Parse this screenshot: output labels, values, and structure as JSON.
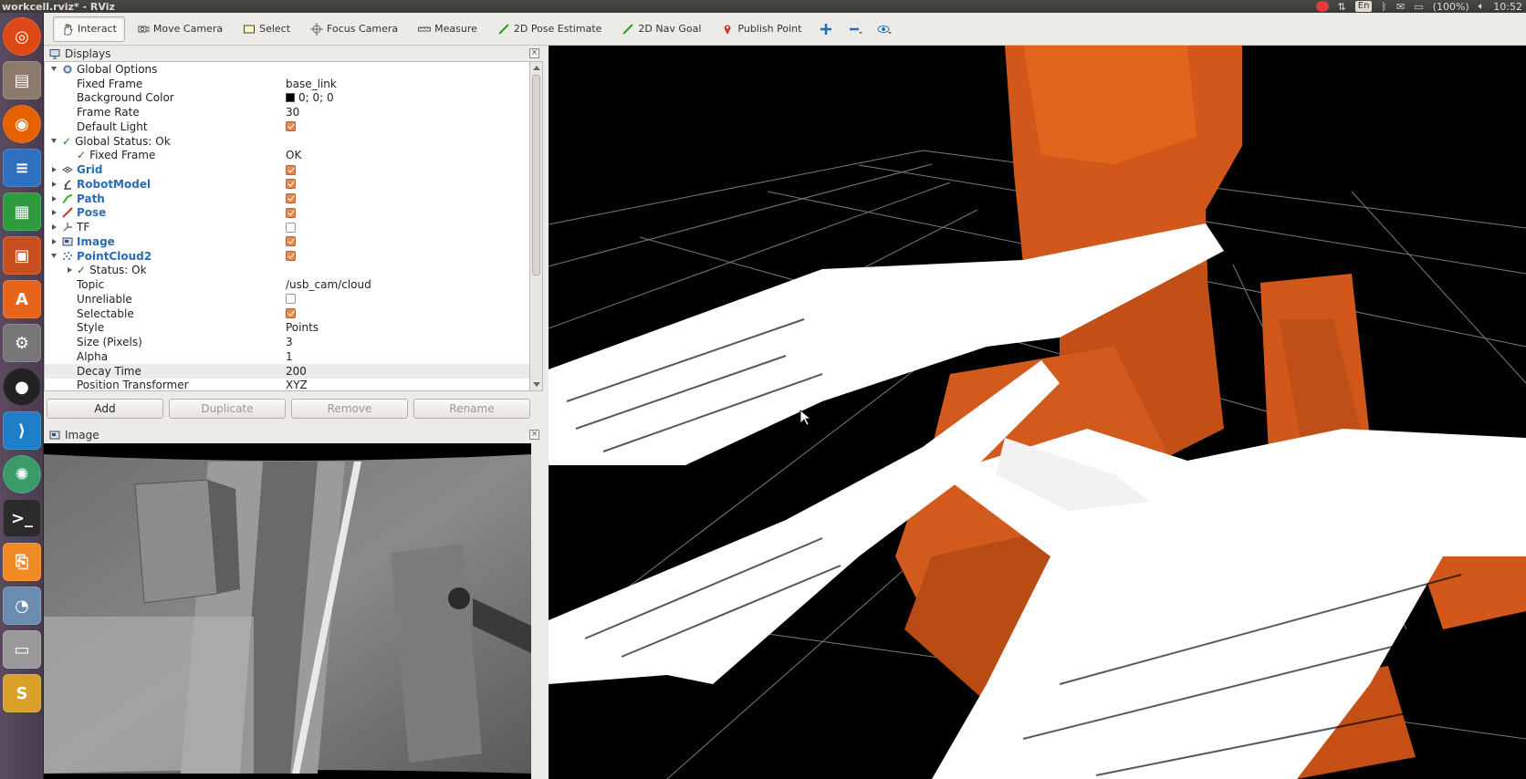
{
  "window": {
    "title": "workcell.rviz* - RViz"
  },
  "tray": {
    "lang": "En",
    "battery": "(100%)",
    "time": "10:52"
  },
  "toolbar": {
    "tools": [
      {
        "label": "Interact",
        "icon": "hand-icon"
      },
      {
        "label": "Move Camera",
        "icon": "move-camera-icon"
      },
      {
        "label": "Select",
        "icon": "select-icon"
      },
      {
        "label": "Focus Camera",
        "icon": "focus-camera-icon"
      },
      {
        "label": "Measure",
        "icon": "measure-icon"
      },
      {
        "label": "2D Pose Estimate",
        "icon": "pose-estimate-icon"
      },
      {
        "label": "2D Nav Goal",
        "icon": "nav-goal-icon"
      },
      {
        "label": "Publish Point",
        "icon": "publish-point-icon"
      }
    ]
  },
  "displays": {
    "title": "Displays",
    "rows": [
      {
        "name": "Global Options"
      },
      {
        "name": "Fixed Frame",
        "value": "base_link"
      },
      {
        "name": "Background Color",
        "value": "0; 0; 0"
      },
      {
        "name": "Frame Rate",
        "value": "30"
      },
      {
        "name": "Default Light"
      },
      {
        "name": "Global Status: Ok"
      },
      {
        "name": "Fixed Frame",
        "value": "OK"
      },
      {
        "name": "Grid"
      },
      {
        "name": "RobotModel"
      },
      {
        "name": "Path"
      },
      {
        "name": "Pose"
      },
      {
        "name": "TF"
      },
      {
        "name": "Image"
      },
      {
        "name": "PointCloud2"
      },
      {
        "name": "Status: Ok"
      },
      {
        "name": "Topic",
        "value": "/usb_cam/cloud"
      },
      {
        "name": "Unreliable"
      },
      {
        "name": "Selectable"
      },
      {
        "name": "Style",
        "value": "Points"
      },
      {
        "name": "Size (Pixels)",
        "value": "3"
      },
      {
        "name": "Alpha",
        "value": "1"
      },
      {
        "name": "Decay Time",
        "value": "200"
      },
      {
        "name": "Position Transformer",
        "value": "XYZ"
      }
    ],
    "buttons": {
      "add": "Add",
      "duplicate": "Duplicate",
      "remove": "Remove",
      "rename": "Rename"
    }
  },
  "image_panel": {
    "title": "Image"
  },
  "colors": {
    "accent_orange": "#d95f1c",
    "check_orange": "#e8884e",
    "link_blue": "#2a6cb5",
    "status_green": "#1f7a1f"
  }
}
